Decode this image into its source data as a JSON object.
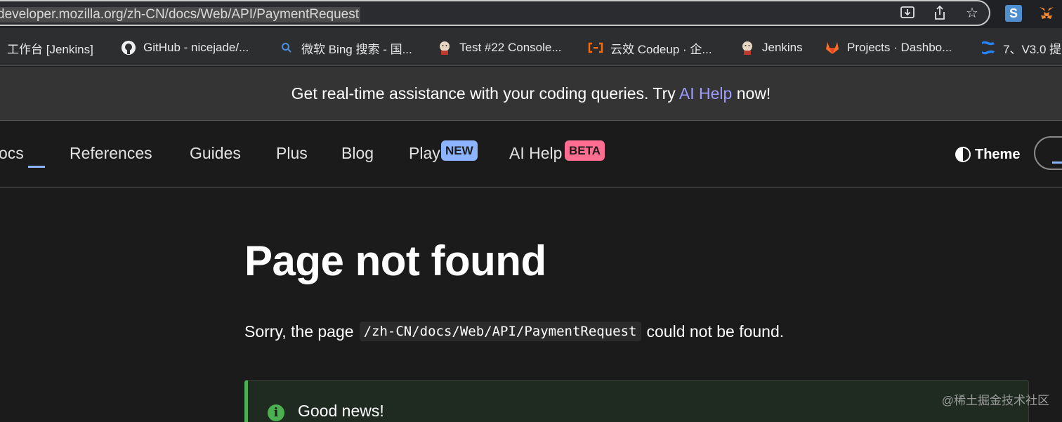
{
  "browser": {
    "url": "developer.mozilla.org/zh-CN/docs/Web/API/PaymentRequest",
    "icons": [
      "install-icon",
      "share-icon",
      "star-icon"
    ],
    "extension_label": "S"
  },
  "bookmarks": [
    {
      "label": "工作台 [Jenkins]",
      "icon": "jenkins-icon"
    },
    {
      "label": "GitHub - nicejade/...",
      "icon": "github-icon"
    },
    {
      "label": "微软 Bing 搜索 - 国...",
      "icon": "search-icon"
    },
    {
      "label": "Test #22 Console...",
      "icon": "jenkins-icon"
    },
    {
      "label": "云效 Codeup · 企...",
      "icon": "codeup-icon"
    },
    {
      "label": "Jenkins",
      "icon": "jenkins-icon"
    },
    {
      "label": "Projects · Dashbo...",
      "icon": "gitlab-icon"
    },
    {
      "label": "7、V3.0 提",
      "icon": "confluence-icon"
    }
  ],
  "banner": {
    "before": "Get real-time assistance with your coding queries. Try ",
    "link": "AI Help",
    "after": " now!"
  },
  "nav": {
    "docs": "ocs",
    "references": "References",
    "guides": "Guides",
    "plus": "Plus",
    "blog": "Blog",
    "play": "Play",
    "play_badge": "NEW",
    "aihelp": "AI Help",
    "aihelp_badge": "BETA",
    "theme": "Theme"
  },
  "main": {
    "title": "Page not found",
    "sorry_before": "Sorry, the page",
    "sorry_path": "/zh-CN/docs/Web/API/PaymentRequest",
    "sorry_after": "could not be found.",
    "note_icon": "i",
    "note_title": "Good news!"
  },
  "watermark": "@稀土掘金技术社区",
  "colors": {
    "accent": "#8cb4ff",
    "link": "#9e9bff",
    "beta": "#ff6d91",
    "success": "#4caf50"
  }
}
